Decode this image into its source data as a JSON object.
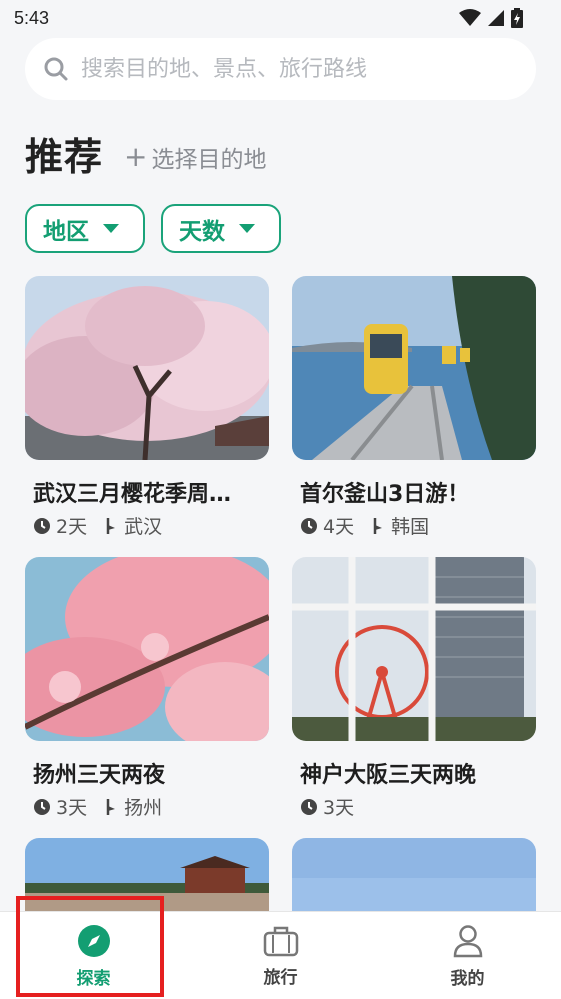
{
  "status": {
    "time": "5:43"
  },
  "search": {
    "placeholder": "搜索目的地、景点、旅行路线"
  },
  "header": {
    "title": "推荐",
    "select_destination": "选择目的地"
  },
  "filters": [
    {
      "label": "地区"
    },
    {
      "label": "天数"
    }
  ],
  "cards": [
    {
      "title": "武汉三月樱花季周…",
      "days": "2天",
      "location": "武汉",
      "image": "cherry-blossom-tree"
    },
    {
      "title": "首尔釜山3日游！",
      "days": "4天",
      "location": "韩国",
      "image": "sky-capsule-train"
    },
    {
      "title": "扬州三天两夜",
      "days": "3天",
      "location": "扬州",
      "image": "pink-blossoms"
    },
    {
      "title": "神户大阪三天两晚",
      "days": "3天",
      "image": "ferris-wheel"
    },
    {
      "image": "city-wall"
    },
    {
      "image": "blue-sky"
    }
  ],
  "nav": {
    "items": [
      {
        "label": "探索",
        "icon": "compass-icon",
        "active": true
      },
      {
        "label": "旅行",
        "icon": "suitcase-icon",
        "active": false
      },
      {
        "label": "我的",
        "icon": "person-icon",
        "active": false
      }
    ]
  },
  "colors": {
    "accent": "#139e72",
    "highlight": "#e51f1f",
    "background": "#f5f6f8"
  }
}
